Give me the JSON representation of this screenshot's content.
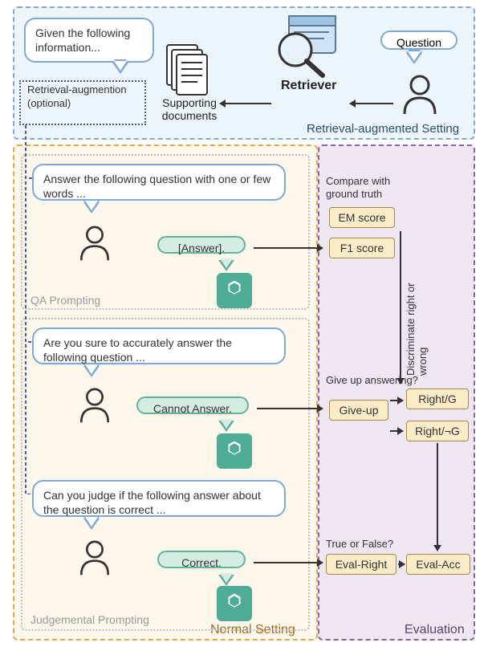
{
  "retriever": {
    "given_bubble": "Given the following information...",
    "question_bubble": "Question",
    "supporting_docs": "Supporting documents",
    "retriever_label": "Retriever",
    "rag_opt_label": "Retrieval-augmention (optional)",
    "panel_label": "Retrieval-augmented Setting"
  },
  "normal": {
    "panel_label": "Normal Setting",
    "qa_prompt_label": "QA Prompting",
    "judge_prompt_label": "Judgemental Prompting",
    "qa_bubble": "Answer the following question with one or few words ...",
    "qa_answer": "[Answer].",
    "sure_bubble": "Are you sure to accurately answer the following question ...",
    "sure_answer": "Cannot Answer.",
    "judge_bubble": "Can you judge if the following answer about the question is correct ...",
    "judge_answer": "Correct."
  },
  "eval": {
    "panel_label": "Evaluation",
    "compare_label": "Compare with ground truth",
    "em": "EM score",
    "f1": "F1 score",
    "discriminate_label": "Discriminate right or wrong",
    "giveup_label": "Give up answering?",
    "giveup_box": "Give-up",
    "rightg": "Right/G",
    "rightng": "Right/¬G",
    "tf_label": "True or False?",
    "evalright": "Eval-Right",
    "evalacc": "Eval-Acc"
  }
}
